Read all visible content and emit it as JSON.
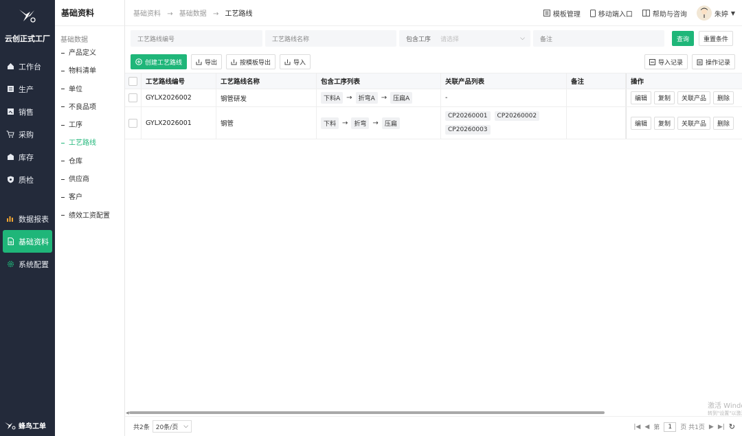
{
  "nav": {
    "company": "云创正式工厂",
    "items": [
      {
        "label": "工作台",
        "icon": "home-icon"
      },
      {
        "label": "生产",
        "icon": "production-icon"
      },
      {
        "label": "销售",
        "icon": "sales-icon"
      },
      {
        "label": "采购",
        "icon": "cart-icon"
      },
      {
        "label": "库存",
        "icon": "warehouse-icon"
      },
      {
        "label": "质检",
        "icon": "shield-icon"
      }
    ],
    "items2": [
      {
        "label": "数据报表",
        "icon": "bar-chart-icon"
      },
      {
        "label": "基础资料",
        "icon": "document-icon"
      },
      {
        "label": "系统配置",
        "icon": "gear-icon"
      }
    ],
    "brand": "蜂鸟工单"
  },
  "subnav": {
    "title": "基础资料",
    "group": "基础数据",
    "items": [
      "产品定义",
      "物料清单",
      "单位",
      "不良品项",
      "工序",
      "工艺路线",
      "仓库",
      "供应商",
      "客户",
      "绩效工资配置"
    ]
  },
  "breadcrumb": {
    "a": "基础资料",
    "b": "基础数据",
    "c": "工艺路线"
  },
  "header": {
    "template": "模板管理",
    "mobile": "移动端入口",
    "help": "帮助与咨询",
    "user": "朱婷"
  },
  "filters": {
    "code_placeholder": "工艺路线编号",
    "name_placeholder": "工艺路线名称",
    "process_label": "包含工序",
    "process_placeholder": "请选择",
    "remark_placeholder": "备注",
    "query": "查询",
    "reset": "重置条件"
  },
  "toolbar": {
    "create": "创建工艺路线",
    "export": "导出",
    "export_tpl": "按模板导出",
    "import": "导入",
    "import_log": "导入记录",
    "op_log": "操作记录"
  },
  "table": {
    "headers": [
      "工艺路线编号",
      "工艺路线名称",
      "包含工序列表",
      "关联产品列表",
      "备注",
      "操作"
    ],
    "rows": [
      {
        "code": "GYLX2026002",
        "name": "钢管研发",
        "steps": [
          "下料A",
          "折弯A",
          "压扁A"
        ],
        "products": [],
        "products_text": "-",
        "remark": ""
      },
      {
        "code": "GYLX2026001",
        "name": "钢管",
        "steps": [
          "下料",
          "折弯",
          "压扁"
        ],
        "products": [
          "CP20260001",
          "CP20260002",
          "CP20260003"
        ],
        "products_text": "",
        "remark": ""
      }
    ],
    "actions": [
      "编辑",
      "复制",
      "关联产品",
      "删除"
    ]
  },
  "footer": {
    "total": "共2条",
    "page_size": "20条/页",
    "page_prefix": "第",
    "page": "1",
    "page_suffix": "页 共1页"
  },
  "watermark": {
    "line1": "激活 Windows",
    "line2": "转到\"设置\"以激活"
  }
}
